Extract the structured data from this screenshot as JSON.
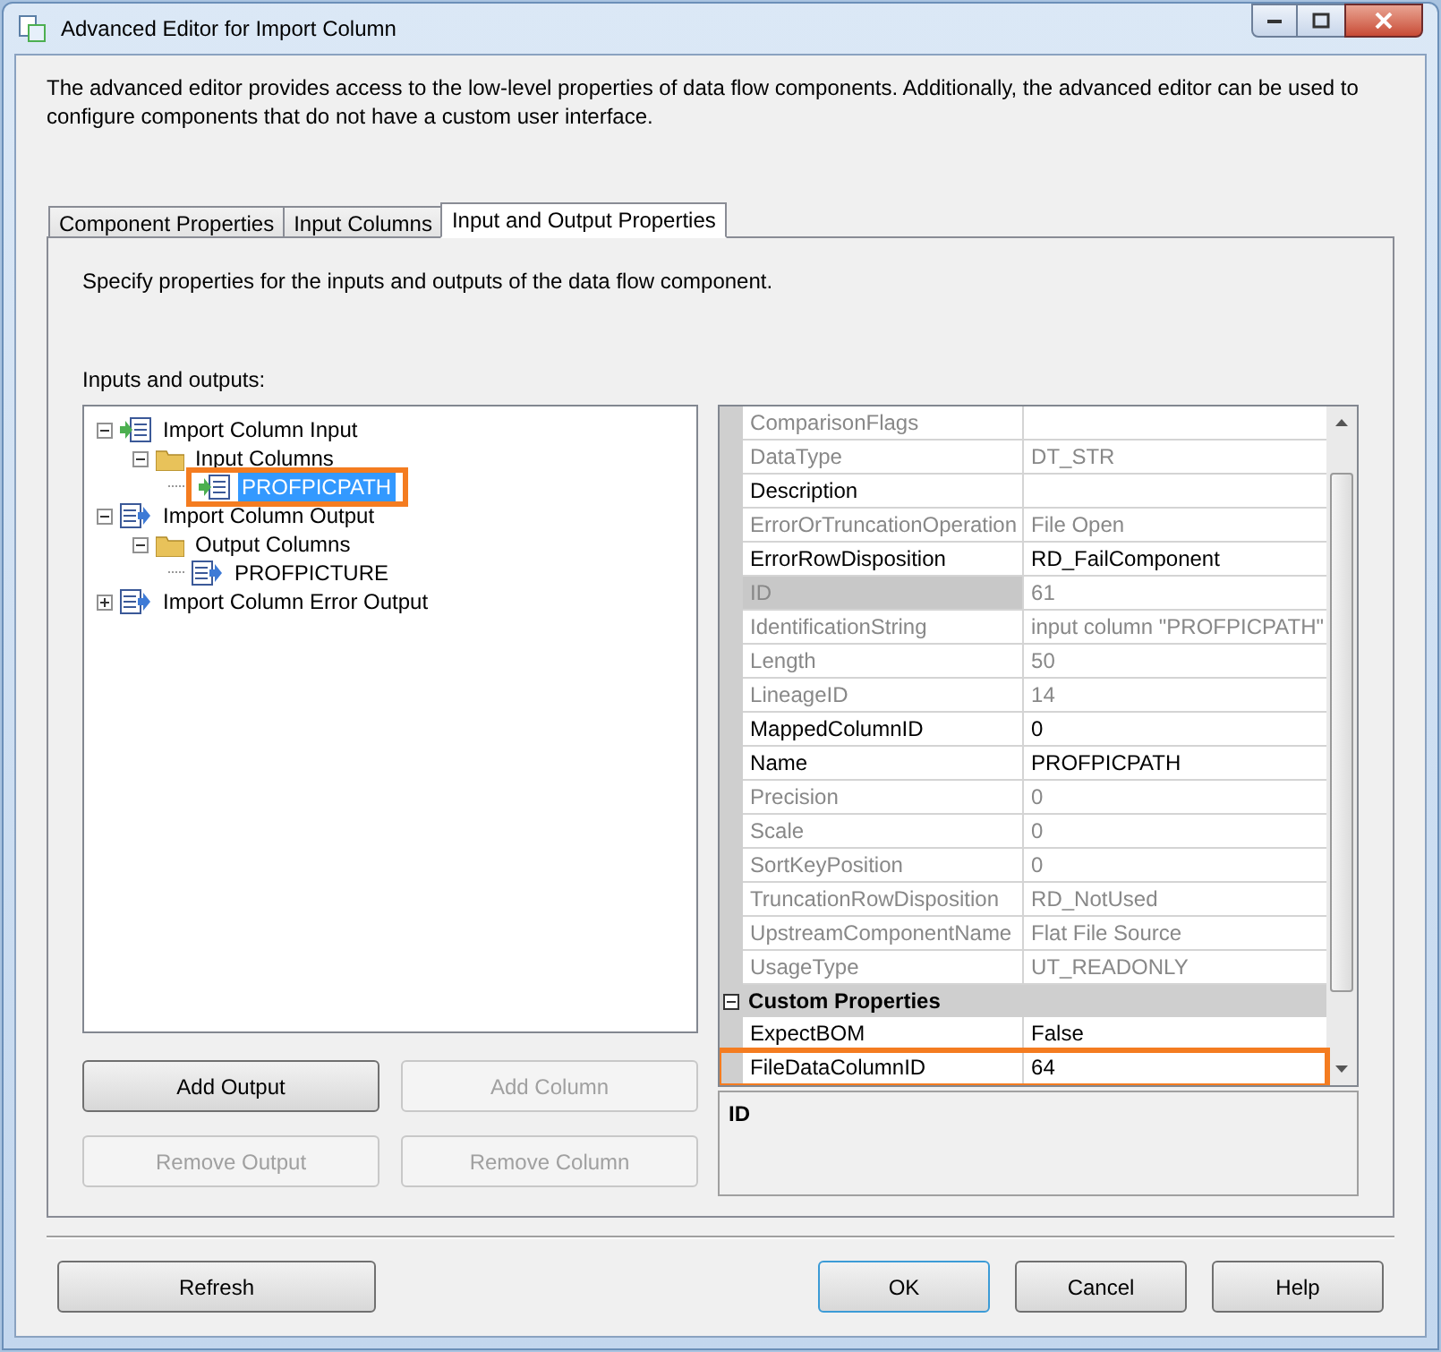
{
  "window": {
    "title": "Advanced Editor for Import Column"
  },
  "description": "The advanced editor provides access to the low-level properties of data flow components. Additionally, the advanced editor can be used to configure components that do not have a custom user interface.",
  "tabs": [
    {
      "label": "Component Properties",
      "selected": false
    },
    {
      "label": "Input Columns",
      "selected": false
    },
    {
      "label": "Input and Output Properties",
      "selected": true
    }
  ],
  "panel_hint": "Specify properties for the inputs and outputs of the data flow component.",
  "tree_label": "Inputs and outputs:",
  "tree": [
    {
      "label": "Import Column Input",
      "kind": "input",
      "expanded": true,
      "selected": false,
      "highlighted": false,
      "children": [
        {
          "label": "Input Columns",
          "kind": "folder",
          "expanded": true,
          "selected": false,
          "highlighted": false,
          "children": [
            {
              "label": "PROFPICPATH",
              "kind": "input-column",
              "selected": true,
              "highlighted": true
            }
          ]
        }
      ]
    },
    {
      "label": "Import Column Output",
      "kind": "output",
      "expanded": true,
      "selected": false,
      "highlighted": false,
      "children": [
        {
          "label": "Output Columns",
          "kind": "folder",
          "expanded": true,
          "selected": false,
          "highlighted": false,
          "children": [
            {
              "label": "PROFPICTURE",
              "kind": "output-column",
              "selected": false,
              "highlighted": false
            }
          ]
        }
      ]
    },
    {
      "label": "Import Column Error Output",
      "kind": "output",
      "expanded": false,
      "selected": false,
      "highlighted": false
    }
  ],
  "tree_buttons": [
    {
      "label": "Add Output",
      "disabled": false
    },
    {
      "label": "Add Column",
      "disabled": true
    },
    {
      "label": "Remove Output",
      "disabled": true
    },
    {
      "label": "Remove Column",
      "disabled": true
    }
  ],
  "properties": [
    {
      "kind": "row",
      "name": "ComparisonFlags",
      "editable": false,
      "selected": false,
      "highlighted": false
    },
    {
      "kind": "row",
      "name": "DataType",
      "value": "DT_STR",
      "editable": false,
      "selected": false,
      "highlighted": false
    },
    {
      "kind": "row",
      "name": "Description",
      "editable": true,
      "selected": false,
      "highlighted": false
    },
    {
      "kind": "row",
      "name": "ErrorOrTruncationOperation",
      "value": "File Open",
      "editable": false,
      "selected": false,
      "highlighted": false
    },
    {
      "kind": "row",
      "name": "ErrorRowDisposition",
      "value": "RD_FailComponent",
      "editable": true,
      "selected": false,
      "highlighted": false
    },
    {
      "kind": "row",
      "name": "ID",
      "value": "61",
      "editable": false,
      "selected": true,
      "highlighted": false
    },
    {
      "kind": "row",
      "name": "IdentificationString",
      "value": "input column \"PROFPICPATH\"",
      "editable": false,
      "selected": false,
      "highlighted": false
    },
    {
      "kind": "row",
      "name": "Length",
      "value": "50",
      "editable": false,
      "selected": false,
      "highlighted": false
    },
    {
      "kind": "row",
      "name": "LineageID",
      "value": "14",
      "editable": false,
      "selected": false,
      "highlighted": false
    },
    {
      "kind": "row",
      "name": "MappedColumnID",
      "value": "0",
      "editable": true,
      "selected": false,
      "highlighted": false
    },
    {
      "kind": "row",
      "name": "Name",
      "value": "PROFPICPATH",
      "editable": true,
      "selected": false,
      "highlighted": false
    },
    {
      "kind": "row",
      "name": "Precision",
      "value": "0",
      "editable": false,
      "selected": false,
      "highlighted": false
    },
    {
      "kind": "row",
      "name": "Scale",
      "value": "0",
      "editable": false,
      "selected": false,
      "highlighted": false
    },
    {
      "kind": "row",
      "name": "SortKeyPosition",
      "value": "0",
      "editable": false,
      "selected": false,
      "highlighted": false
    },
    {
      "kind": "row",
      "name": "TruncationRowDisposition",
      "value": "RD_NotUsed",
      "editable": false,
      "selected": false,
      "highlighted": false
    },
    {
      "kind": "row",
      "name": "UpstreamComponentName",
      "value": "Flat File Source",
      "editable": false,
      "selected": false,
      "highlighted": false
    },
    {
      "kind": "row",
      "name": "UsageType",
      "value": "UT_READONLY",
      "editable": false,
      "selected": false,
      "highlighted": false
    },
    {
      "kind": "category",
      "name": "Custom Properties",
      "expanded": true
    },
    {
      "kind": "row",
      "name": "ExpectBOM",
      "value": "False",
      "editable": true,
      "selected": false,
      "highlighted": false
    },
    {
      "kind": "row",
      "name": "FileDataColumnID",
      "value": "64",
      "editable": true,
      "selected": false,
      "highlighted": true
    }
  ],
  "property_help": {
    "title": "ID"
  },
  "dialog_buttons": [
    {
      "label": "Refresh",
      "default": false
    },
    {
      "label": "OK",
      "default": true
    },
    {
      "label": "Cancel",
      "default": false
    },
    {
      "label": "Help",
      "default": false
    }
  ]
}
